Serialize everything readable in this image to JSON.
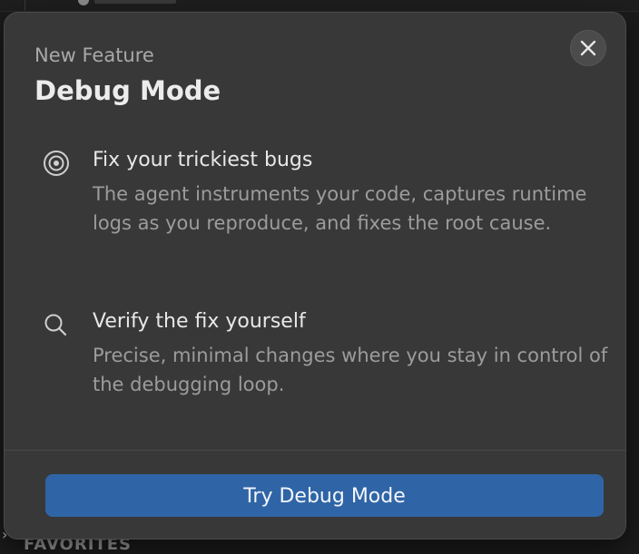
{
  "background": {
    "bottom_section_label": "FAVORITES"
  },
  "dialog": {
    "eyebrow": "New Feature",
    "title": "Debug Mode",
    "close_icon": "close-icon",
    "features": [
      {
        "icon": "target-icon",
        "title": "Fix your trickiest bugs",
        "description": "The agent instruments your code, captures runtime logs as you reproduce, and fixes the root cause."
      },
      {
        "icon": "search-icon",
        "title": "Verify the fix yourself",
        "description": "Precise, minimal changes where you stay in control of the debugging loop."
      }
    ],
    "primary_button": "Try Debug Mode"
  },
  "colors": {
    "dialog_bg": "#383838",
    "primary_button_bg": "#2f65a6",
    "title_text": "#ececec",
    "muted_text": "#9c9c9c"
  }
}
